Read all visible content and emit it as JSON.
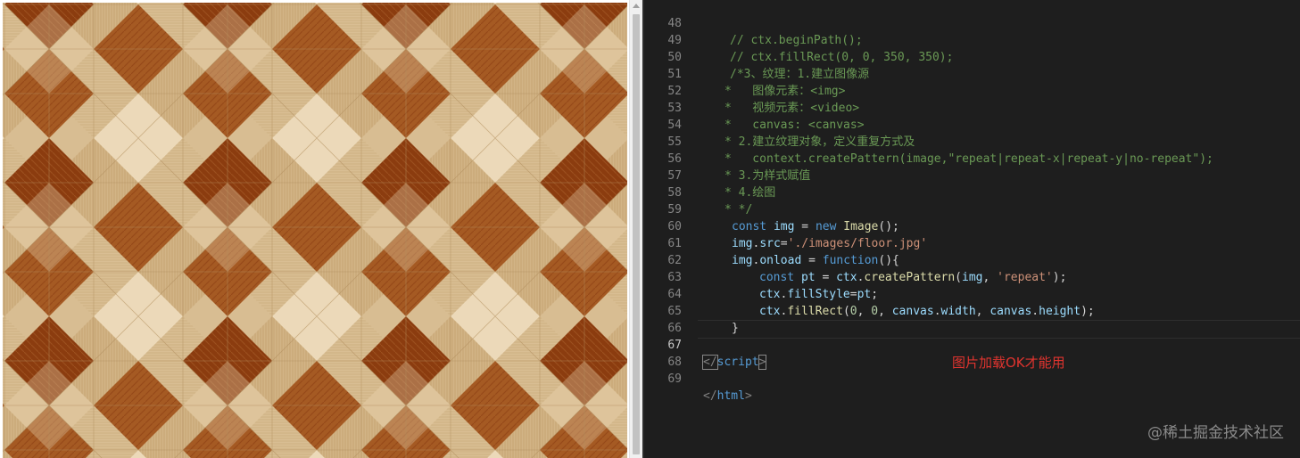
{
  "preview": {
    "pattern": "wood parquet floor",
    "colors": {
      "light_oak": "#d8bd92",
      "pale_oak": "#ead6b4",
      "grain": "#b89568",
      "dark_walnut": "#8a3b0e",
      "mid_walnut": "#a35520",
      "grout": "#c2a478"
    }
  },
  "editor": {
    "lines": [
      {
        "n": "48",
        "indent": "    ",
        "text": "// ctx.beginPath();"
      },
      {
        "n": "49",
        "indent": "    ",
        "text": "// ctx.fillRect(0, 0, 350, 350);"
      },
      {
        "n": "50",
        "indent": "    ",
        "text": "/*3、纹理：1.建立图像源"
      },
      {
        "n": "51",
        "indent": "   ",
        "text": "*   图像元素：<img>"
      },
      {
        "n": "52",
        "indent": "   ",
        "text": "*   视频元素：<video>"
      },
      {
        "n": "53",
        "indent": "   ",
        "text": "*   canvas: <canvas>"
      },
      {
        "n": "54",
        "indent": "   ",
        "text": "* 2.建立纹理对象，定义重复方式及"
      },
      {
        "n": "55",
        "indent": "   ",
        "text": "*   context.createPattern(image,\"repeat|repeat-x|repeat-y|no-repeat\");"
      },
      {
        "n": "56",
        "indent": "   ",
        "text": "* 3.为样式赋值"
      },
      {
        "n": "57",
        "indent": "   ",
        "text": "* 4.绘图"
      },
      {
        "n": "58",
        "indent": "   ",
        "text": "* */"
      },
      {
        "n": "59",
        "kw": "const",
        "var": "img",
        "op": " = ",
        "kw2": "new",
        "fn": "Image",
        "rest": "();"
      },
      {
        "n": "60",
        "var": "img",
        "prop": "src",
        "op": "=",
        "str": "'./images/floor.jpg'"
      },
      {
        "n": "61",
        "var": "img",
        "prop": "onload",
        "op": " = ",
        "kw": "function",
        "rest": "(){"
      },
      {
        "n": "62",
        "kw": "const",
        "var": "pt",
        "op": " = ",
        "obj": "ctx",
        "fn": "createPattern",
        "arg": "img",
        "str": "'repeat'",
        "rest": ");"
      },
      {
        "n": "63",
        "obj": "ctx",
        "prop": "fillStyle",
        "op": "=",
        "val": "pt",
        "rest": ";"
      },
      {
        "n": "64",
        "obj": "ctx",
        "fn": "fillRect",
        "num1": "0",
        "num2": "0",
        "arg1": "canvas",
        "p1": "width",
        "arg2": "canvas",
        "p2": "height",
        "rest": ");"
      },
      {
        "n": "65",
        "text": "}"
      },
      {
        "n": "66",
        "text": ""
      },
      {
        "n": "67",
        "open": "</",
        "tag": "script",
        "close": ">"
      },
      {
        "n": "68",
        "text": ""
      },
      {
        "n": "69",
        "open": "</",
        "tag": "html",
        "close": ">"
      }
    ],
    "annotation": "图片加载OK才能用",
    "watermark": "@稀土掘金技术社区"
  }
}
